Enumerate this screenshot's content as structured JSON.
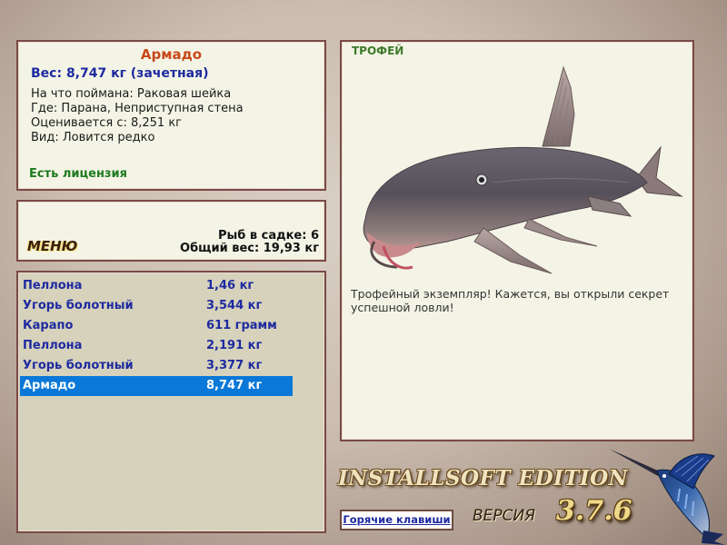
{
  "fish": {
    "name": "Армадо",
    "weight_line": "Вес: 8,747 кг (зачетная)",
    "bait_line": "На что поймана: Раковая шейка",
    "location_line": "Где: Парана, Неприступная стена",
    "value_line": "Оценивается с: 8,251 кг",
    "rarity_line": "Вид: Ловится редко",
    "license": "Есть лицензия"
  },
  "menu": {
    "label": "МЕНЮ",
    "keep_count": "Рыб в садке: 6",
    "keep_weight": "Общий вес: 19,93 кг"
  },
  "catch_list": [
    {
      "name": "Пеллона",
      "weight": "1,46 кг",
      "selected": false
    },
    {
      "name": "Угорь болотный",
      "weight": "3,544 кг",
      "selected": false
    },
    {
      "name": "Карапо",
      "weight": "611 грамм",
      "selected": false
    },
    {
      "name": "Пеллона",
      "weight": "2,191 кг",
      "selected": false
    },
    {
      "name": "Угорь болотный",
      "weight": "3,377 кг",
      "selected": false
    },
    {
      "name": "Армадо",
      "weight": "8,747 кг",
      "selected": true
    }
  ],
  "trophy": {
    "title": "ТРОФЕЙ",
    "text": "Трофейный экземпляр! Кажется, вы открыли секрет успешной ловли!"
  },
  "branding": {
    "edition": "INSTALLSOFT EDITION",
    "version_label": "ВЕРСИЯ",
    "version_number": "3.7.6",
    "hotkeys": "Горячие клавиши"
  },
  "icons": {
    "fish_picture": "catfish-image",
    "logo": "marlin-logo"
  },
  "colors": {
    "selection": "#0a78d8",
    "list_text": "#1e2aa0",
    "name_accent": "#c8481a",
    "license_green": "#1e7a1e"
  }
}
